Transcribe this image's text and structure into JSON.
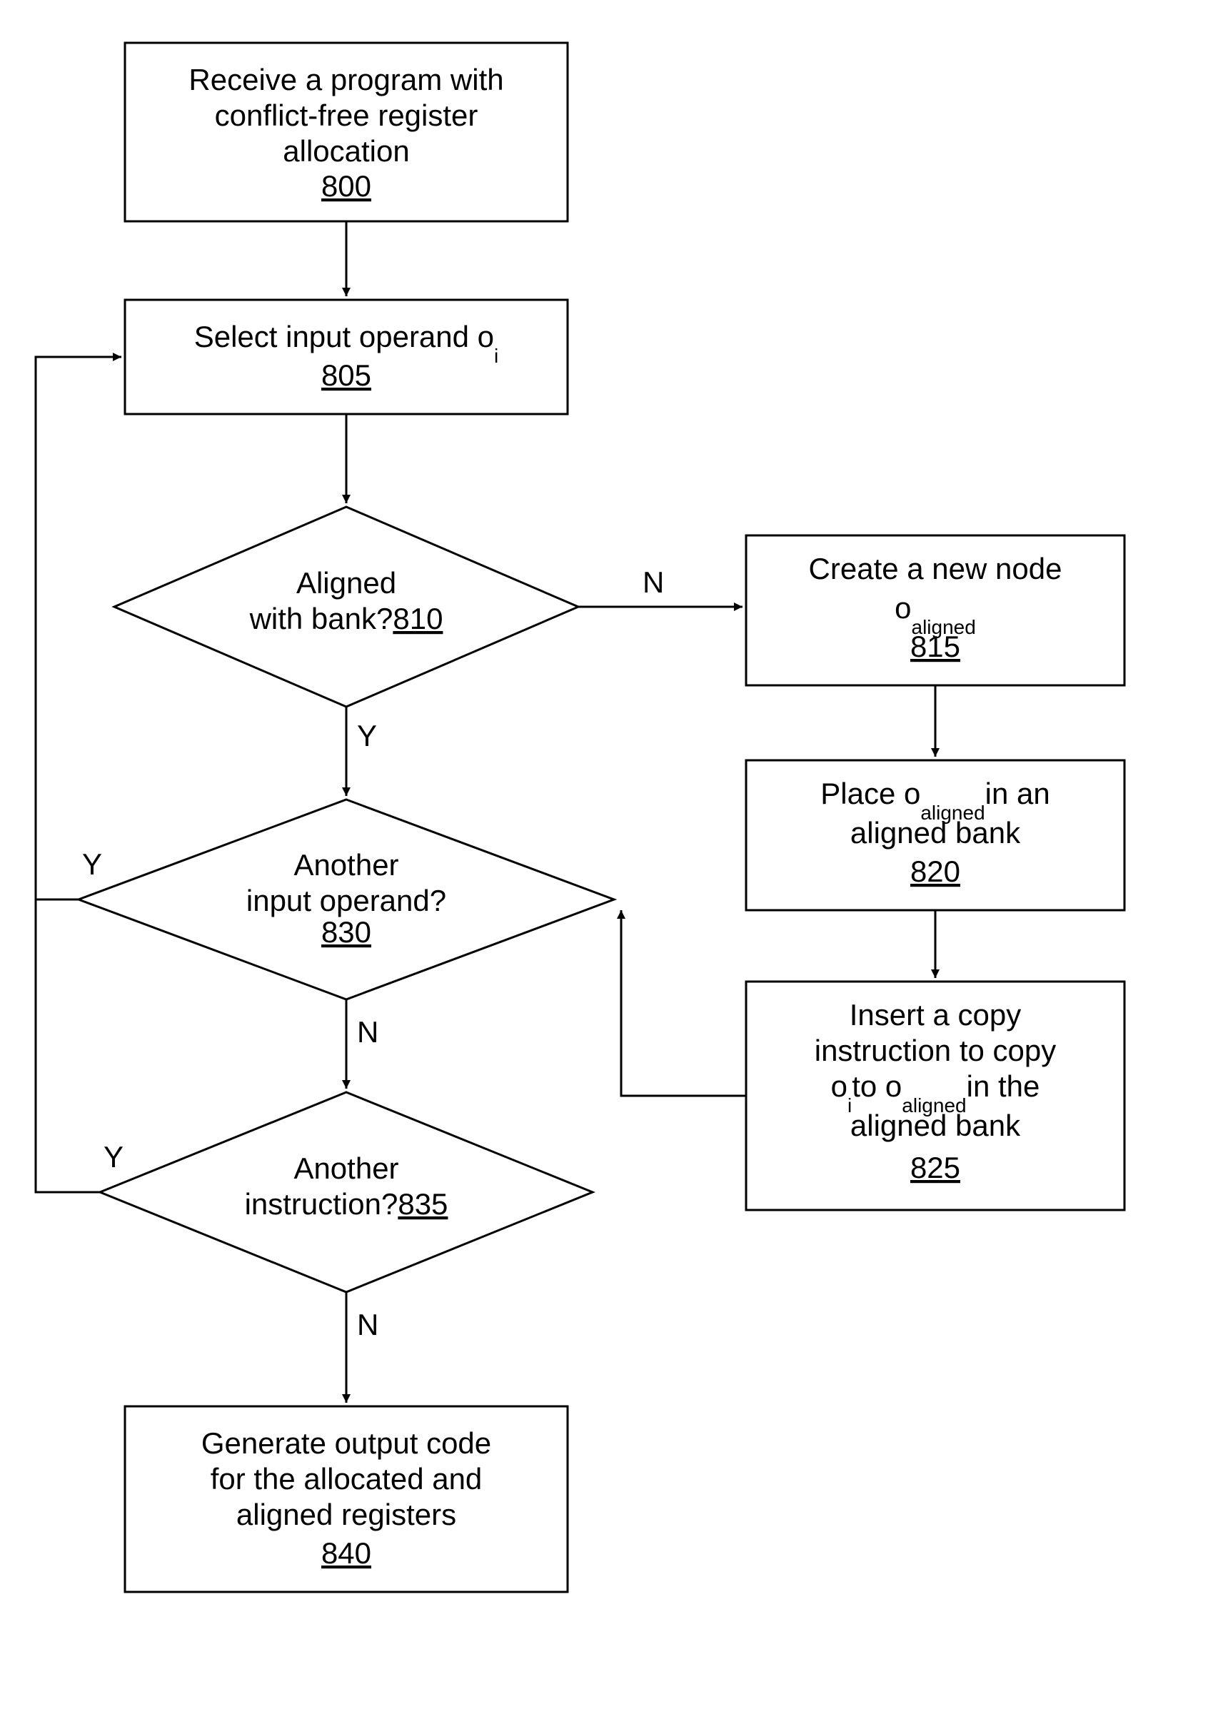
{
  "chart_data": {
    "type": "flowchart",
    "nodes": [
      {
        "id": "800",
        "shape": "rect",
        "text": "Receive a program with conflict-free register allocation",
        "ref": "800"
      },
      {
        "id": "805",
        "shape": "rect",
        "text": "Select input operand o_i",
        "ref": "805"
      },
      {
        "id": "810",
        "shape": "diamond",
        "text": "Aligned with bank?",
        "ref": "810"
      },
      {
        "id": "815",
        "shape": "rect",
        "text": "Create a new node o_aligned",
        "ref": "815"
      },
      {
        "id": "820",
        "shape": "rect",
        "text": "Place o_aligned in an aligned bank",
        "ref": "820"
      },
      {
        "id": "825",
        "shape": "rect",
        "text": "Insert a copy instruction to copy o_i to o_aligned in the aligned bank",
        "ref": "825"
      },
      {
        "id": "830",
        "shape": "diamond",
        "text": "Another input operand?",
        "ref": "830"
      },
      {
        "id": "835",
        "shape": "diamond",
        "text": "Another instruction?",
        "ref": "835"
      },
      {
        "id": "840",
        "shape": "rect",
        "text": "Generate output code for the allocated and aligned registers",
        "ref": "840"
      }
    ],
    "edges": [
      {
        "from": "800",
        "to": "805",
        "label": ""
      },
      {
        "from": "805",
        "to": "810",
        "label": ""
      },
      {
        "from": "810",
        "to": "830",
        "label": "Y"
      },
      {
        "from": "810",
        "to": "815",
        "label": "N"
      },
      {
        "from": "815",
        "to": "820",
        "label": ""
      },
      {
        "from": "820",
        "to": "825",
        "label": ""
      },
      {
        "from": "825",
        "to": "830",
        "label": ""
      },
      {
        "from": "830",
        "to": "805",
        "label": "Y"
      },
      {
        "from": "830",
        "to": "835",
        "label": "N"
      },
      {
        "from": "835",
        "to": "805",
        "label": "Y"
      },
      {
        "from": "835",
        "to": "840",
        "label": "N"
      }
    ]
  },
  "nodes": {
    "n800": {
      "l1": "Receive a program with",
      "l2": "conflict-free register",
      "l3": "allocation",
      "ref": "800"
    },
    "n805": {
      "l1": "Select input operand o",
      "sub": "i",
      "ref": "805"
    },
    "n810": {
      "l1": "Aligned",
      "l2": "with bank?",
      "ref": "810"
    },
    "n815": {
      "l1": "Create a new node",
      "l2pre": "o",
      "l2sub": "aligned",
      "ref": "815"
    },
    "n820": {
      "l1pre": "Place o",
      "l1sub": "aligned",
      "l1post": "in an",
      "l2": "aligned bank",
      "ref": "820"
    },
    "n825": {
      "l1": "Insert a copy",
      "l2": "instruction to copy",
      "l3pre": "o",
      "l3sub1": "i",
      "l3mid": "to o",
      "l3sub2": "aligned",
      "l3post": "in the",
      "l4": "aligned bank",
      "ref": "825"
    },
    "n830": {
      "l1": "Another",
      "l2": "input operand?",
      "ref": "830"
    },
    "n835": {
      "l1": "Another",
      "l2": "instruction?",
      "ref": "835"
    },
    "n840": {
      "l1": "Generate output code",
      "l2": "for the allocated and",
      "l3": "aligned registers",
      "ref": "840"
    }
  },
  "labels": {
    "Y": "Y",
    "N": "N"
  }
}
